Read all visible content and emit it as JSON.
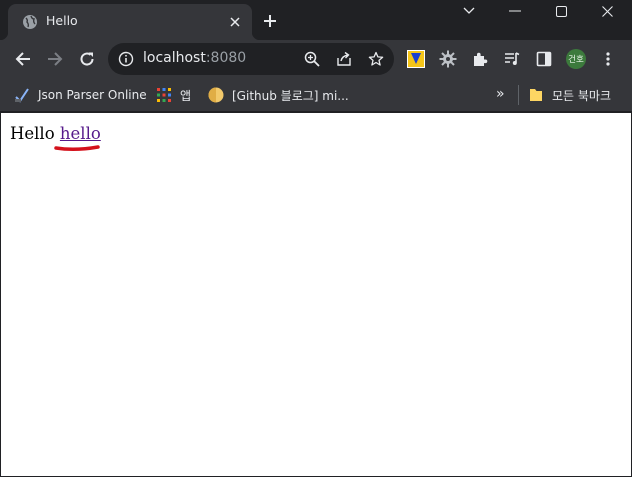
{
  "tab": {
    "title": "Hello"
  },
  "omnibox": {
    "host": "localhost",
    "port": ":8080"
  },
  "profile": {
    "initials": "건호"
  },
  "bookmarks": {
    "items": [
      {
        "label": "Json Parser Online"
      },
      {
        "label": "앱"
      },
      {
        "label": "[Github 블로그] mi..."
      }
    ],
    "more": "»",
    "all_bookmarks": "모든 북마크"
  },
  "page": {
    "text": "Hello",
    "link": "hello"
  },
  "colors": {
    "link": "#551a8b",
    "annotation": "#d4121c",
    "chrome_dark": "#202124",
    "chrome_toolbar": "#35363a"
  }
}
